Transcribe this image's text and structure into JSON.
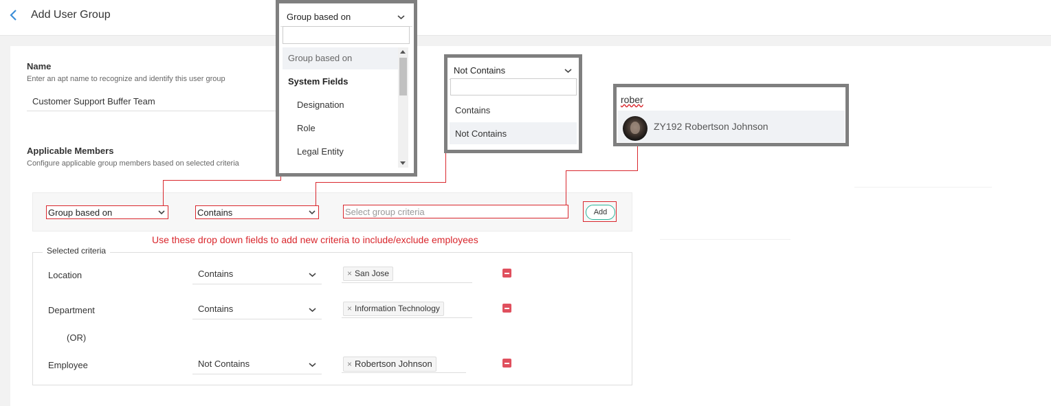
{
  "header": {
    "title": "Add User Group"
  },
  "name_section": {
    "label": "Name",
    "hint": "Enter an apt name to recognize and identify this user group",
    "value": "Customer Support Buffer Team"
  },
  "members_section": {
    "label": "Applicable Members",
    "hint": "Configure applicable group members based on selected criteria"
  },
  "builder": {
    "group_select": "Group based on",
    "operator_select": "Contains",
    "criteria_placeholder": "Select group criteria",
    "add_label": "Add"
  },
  "annotation": "Use these drop down fields to add new criteria to include/exclude employees",
  "selected_criteria": {
    "legend": "Selected criteria",
    "or_label": "(OR)",
    "rows": [
      {
        "field": "Location",
        "operator": "Contains",
        "value": "San Jose"
      },
      {
        "field": "Department",
        "operator": "Contains",
        "value": "Information Technology"
      },
      {
        "field": "Employee",
        "operator": "Not Contains",
        "value": "Robertson Johnson"
      }
    ]
  },
  "group_dropdown": {
    "selected": "Group based on",
    "items": [
      "Group based on",
      "System Fields",
      "Designation",
      "Role",
      "Legal Entity"
    ]
  },
  "operator_dropdown": {
    "selected": "Not Contains",
    "items": [
      "Contains",
      "Not Contains"
    ]
  },
  "employee_search": {
    "query": "rober",
    "result": "ZY192 Robertson Johnson"
  },
  "colors": {
    "accent_red": "#d9262c",
    "add_border": "#2bb59a",
    "remove": "#e0505e",
    "back_arrow": "#3d8fd8"
  }
}
